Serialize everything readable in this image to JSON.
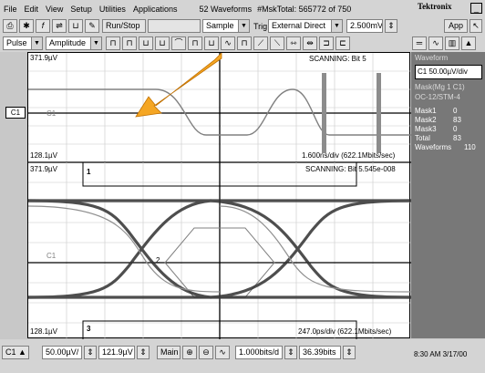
{
  "menu": {
    "items": [
      "File",
      "Edit",
      "View",
      "Setup",
      "Utilities",
      "Applications"
    ],
    "info_waveforms": "52 Waveforms",
    "info_msktotal": "#MskTotal: 565772 of 750",
    "brand": "Tektronix"
  },
  "toolbar1": {
    "run_stop": "Run/Stop",
    "acq_mode": "Sample",
    "trig_label": "Trig",
    "trig_source": "External Direct",
    "trig_level": "2.500mV",
    "app_label": "App"
  },
  "toolbar2": {
    "measure_type": "Pulse",
    "measure_param": "Amplitude"
  },
  "upper_plot": {
    "top_left": "371.9µV",
    "bottom_left": "128.1µV",
    "status": "SCANNING: Bit 5",
    "timebase": "1.600ns/div  (622.1Mbits/sec)",
    "channel_marker": "C1"
  },
  "lower_plot": {
    "top_left": "371.9µV",
    "bottom_left": "128.1µV",
    "status": "SCANNING: Bit 5.545e-008",
    "timebase": "247.0ps/div  (622.1Mbits/sec)",
    "mask_label_1": "1",
    "mask_label_2": "2",
    "mask_label_3": "3",
    "channel_marker": "C1"
  },
  "channel_tag": "C1",
  "side_panel": {
    "title": "Waveform",
    "scale": "C1 50.00µV/div",
    "mask_name": "Mask(Mg 1 C1)",
    "mask_std": "OC-12/STM-4",
    "stats": [
      {
        "label": "Mask1",
        "value": "0"
      },
      {
        "label": "Mask2",
        "value": "83"
      },
      {
        "label": "Mask3",
        "value": "0"
      },
      {
        "label": "Total",
        "value": "83"
      },
      {
        "label": "Waveforms",
        "value": "110"
      }
    ]
  },
  "status_bar": {
    "channel": "C1",
    "vscale": "50.00µV/",
    "offset": "121.9µV",
    "main_label": "Main",
    "bit_rate": "1.000bits/d",
    "length": "36.39bits",
    "time": "8:30 AM 3/17/00"
  },
  "colors": {
    "callout_arrow": "#f5a623",
    "panel_bg": "#787878",
    "plot_bg": "#ffffff"
  }
}
